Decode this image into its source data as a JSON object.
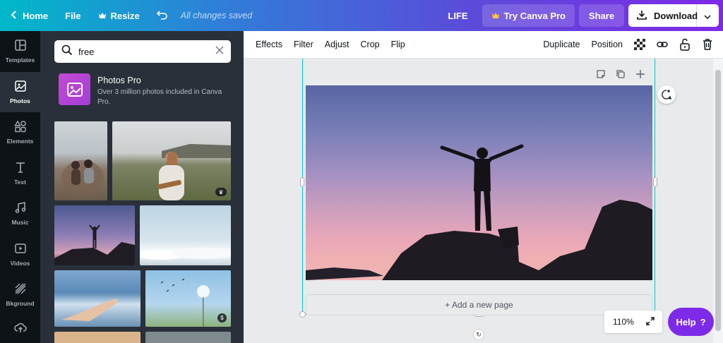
{
  "topbar": {
    "home": "Home",
    "file": "File",
    "resize": "Resize",
    "saved": "All changes saved",
    "doc_title": "LIFE",
    "try_pro": "Try Canva Pro",
    "share": "Share",
    "download": "Download"
  },
  "rail": {
    "items": [
      {
        "label": "Templates",
        "icon": "templates-icon"
      },
      {
        "label": "Photos",
        "icon": "photos-icon"
      },
      {
        "label": "Elements",
        "icon": "elements-icon"
      },
      {
        "label": "Text",
        "icon": "text-icon"
      },
      {
        "label": "Music",
        "icon": "music-icon"
      },
      {
        "label": "Videos",
        "icon": "videos-icon"
      },
      {
        "label": "Bkground",
        "icon": "background-icon"
      }
    ],
    "active": "Photos"
  },
  "panel": {
    "search_value": "free",
    "promo_title": "Photos Pro",
    "promo_desc": "Over 3 million photos included in Canva Pro."
  },
  "toolbar": {
    "effects": "Effects",
    "filter": "Filter",
    "adjust": "Adjust",
    "crop": "Crop",
    "flip": "Flip",
    "duplicate": "Duplicate",
    "position": "Position"
  },
  "canvas": {
    "add_page": "+ Add a new page"
  },
  "zoom": "110%",
  "help": "Help",
  "help_mark": "?",
  "colors": {
    "accent_purple": "#7d2ae8",
    "accent_teal": "#00c4cc",
    "sidebar_dark": "#0e1318",
    "panel_dark": "#293039"
  }
}
